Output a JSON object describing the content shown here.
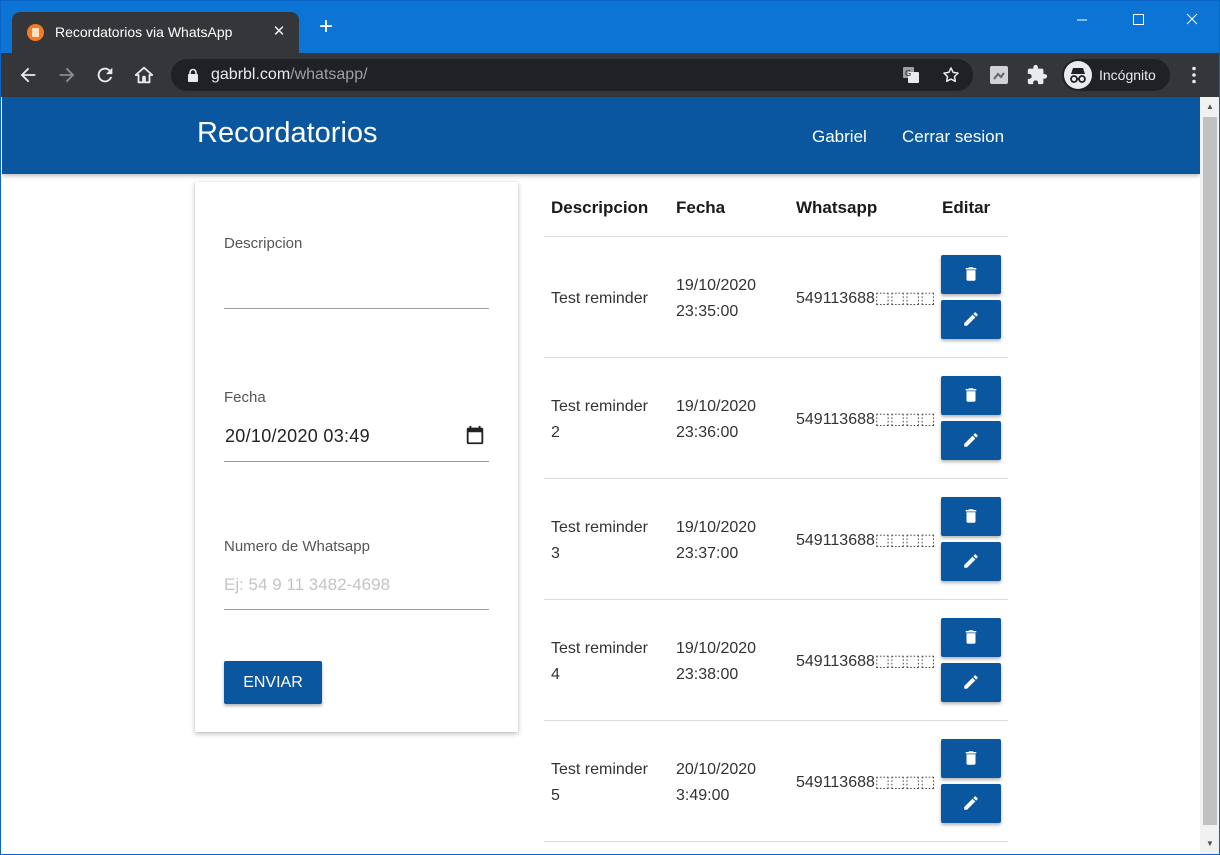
{
  "browser": {
    "tab_title": "Recordatorios via WhatsApp",
    "tab_close": "✕",
    "new_tab": "+",
    "url_host": "gabrbl.com",
    "url_path": "/whatsapp/",
    "profile_label": "Incógnito",
    "window_controls": {
      "minimize": "—",
      "maximize": "☐",
      "close": "✕"
    }
  },
  "navbar": {
    "brand": "Recordatorios",
    "links": [
      "Gabriel",
      "Cerrar sesion"
    ]
  },
  "form": {
    "description_label": "Descripcion",
    "date_label": "Fecha",
    "date_value": "20/10/2020 03:49",
    "whatsapp_label": "Numero de Whatsapp",
    "whatsapp_placeholder": "Ej: 54 9 11 3482-4698",
    "submit_label": "ENVIAR"
  },
  "table": {
    "headers": [
      "Descripcion",
      "Fecha",
      "Whatsapp",
      "Editar"
    ],
    "rows": [
      {
        "desc_line1": "Test reminder",
        "desc_line2": "",
        "date": "19/10/2020",
        "time": "23:35:00",
        "whatsapp": "549113688⬚⬚⬚⬚"
      },
      {
        "desc_line1": "Test reminder",
        "desc_line2": "2",
        "date": "19/10/2020",
        "time": "23:36:00",
        "whatsapp": "549113688⬚⬚⬚⬚"
      },
      {
        "desc_line1": "Test reminder",
        "desc_line2": "3",
        "date": "19/10/2020",
        "time": "23:37:00",
        "whatsapp": "549113688⬚⬚⬚⬚"
      },
      {
        "desc_line1": "Test reminder",
        "desc_line2": "4",
        "date": "19/10/2020",
        "time": "23:38:00",
        "whatsapp": "549113688⬚⬚⬚⬚"
      },
      {
        "desc_line1": "Test reminder",
        "desc_line2": "5",
        "date": "20/10/2020",
        "time": "3:49:00",
        "whatsapp": "549113688⬚⬚⬚⬚"
      }
    ]
  },
  "colors": {
    "titlebar": "#0b74d4",
    "navbar": "#0b579f",
    "button": "#0b579f"
  },
  "icons": {
    "row_actions": [
      "trash-icon",
      "pencil-icon"
    ],
    "date_picker": "calendar-icon"
  }
}
